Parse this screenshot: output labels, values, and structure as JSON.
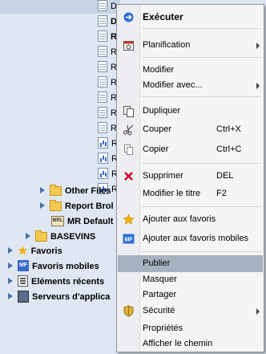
{
  "tree": {
    "items": [
      {
        "label": "D",
        "icon": "document-icon",
        "bold": false
      },
      {
        "label": "D",
        "icon": "document-icon",
        "bold": true
      },
      {
        "label": "R",
        "icon": "document-icon",
        "bold": true
      },
      {
        "label": "R",
        "icon": "document-icon",
        "bold": false
      },
      {
        "label": "R",
        "icon": "document-icon",
        "bold": false
      },
      {
        "label": "R",
        "icon": "document-icon",
        "bold": false
      },
      {
        "label": "R",
        "icon": "document-icon",
        "bold": false
      },
      {
        "label": "R",
        "icon": "document-icon",
        "bold": false
      },
      {
        "label": "R",
        "icon": "document-icon",
        "bold": false
      },
      {
        "label": "R",
        "icon": "chart-icon",
        "bold": false
      },
      {
        "label": "R",
        "icon": "chart-icon",
        "bold": false
      },
      {
        "label": "R",
        "icon": "chart-icon",
        "bold": false
      },
      {
        "label": "R",
        "icon": "chart-icon",
        "bold": false
      }
    ],
    "folders": {
      "other_files": "Other Files",
      "report_broker": "Report Brol",
      "mr_default": "MR Default",
      "basevins": "BASEVINS"
    },
    "roots": {
      "favoris": "Favoris",
      "favoris_mobiles": "Favoris mobiles",
      "elements_recents": "Eléments récents",
      "serveurs": "Serveurs d'applica"
    },
    "mr_icon_text": "MRL"
  },
  "menu": {
    "executer": "Exécuter",
    "planification": "Planification",
    "modifier": "Modifier",
    "modifier_avec": "Modifier avec...",
    "dupliquer": "Dupliquer",
    "couper": "Couper",
    "couper_sc": "Ctrl+X",
    "copier": "Copier",
    "copier_sc": "Ctrl+C",
    "supprimer": "Supprimer",
    "supprimer_sc": "DEL",
    "modifier_titre": "Modifier le titre",
    "modifier_titre_sc": "F2",
    "ajouter_favoris": "Ajouter aux favoris",
    "ajouter_favoris_mobiles": "Ajouter aux favoris mobiles",
    "mf_icon_text": "MF",
    "publier": "Publier",
    "masquer": "Masquer",
    "partager": "Partager",
    "securite": "Sécurité",
    "proprietes": "Propriétés",
    "afficher_chemin": "Afficher le chemin"
  }
}
